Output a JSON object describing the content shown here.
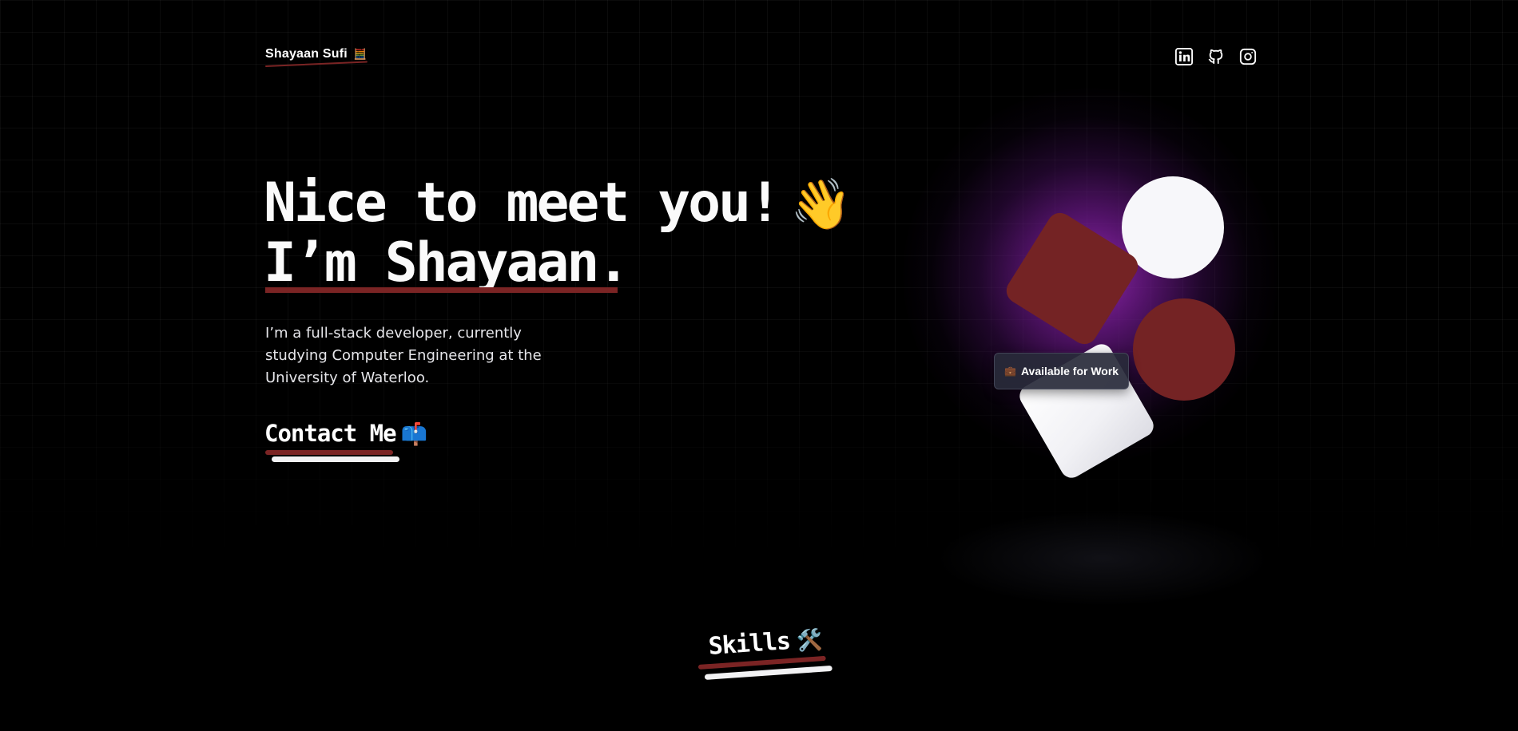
{
  "header": {
    "brand_name": "Shayaan Sufi",
    "brand_emoji": "🧮",
    "social": [
      {
        "name": "linkedin",
        "icon": "linkedin-icon"
      },
      {
        "name": "github",
        "icon": "github-icon"
      },
      {
        "name": "instagram",
        "icon": "instagram-icon"
      }
    ]
  },
  "hero": {
    "headline_line1": "Nice to meet you!",
    "headline_emoji": "👋",
    "headline_line2": "I’m Shayaan.",
    "intro": "I’m a full-stack developer, currently studying Computer Engineering at the University of Waterloo.",
    "contact_label": "Contact Me",
    "contact_emoji": "📫"
  },
  "illustration": {
    "badge_emoji": "💼",
    "badge_label": "Available for Work",
    "colors": {
      "accent_red": "#742324",
      "shape_white": "#f7f7fa",
      "glow_purple": "#9628b4"
    }
  },
  "skills": {
    "title": "Skills",
    "emoji": "🛠️"
  },
  "colors": {
    "background": "#000000",
    "text": "#fafafa",
    "underline_red": "#7b2424"
  }
}
